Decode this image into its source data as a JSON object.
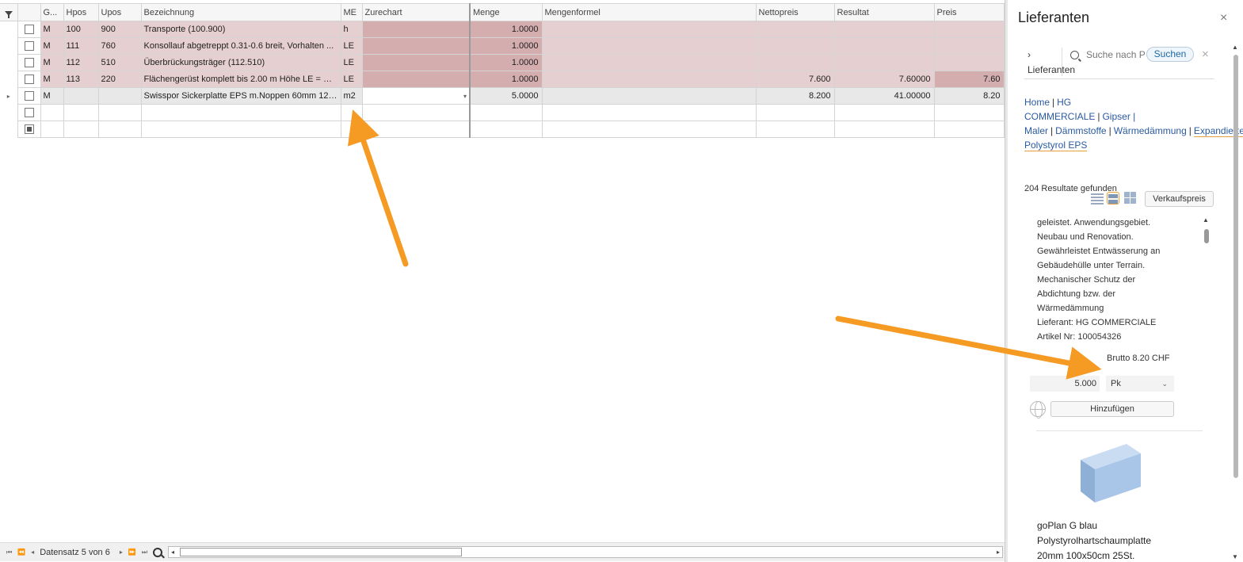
{
  "grid": {
    "columns": [
      "G...",
      "Hpos",
      "Upos",
      "Bezeichnung",
      "ME",
      "Zurechart",
      "Menge",
      "Mengenformel",
      "Nettopreis",
      "Resultat",
      "Preis"
    ],
    "rows": [
      {
        "g": "M",
        "hpos": "100",
        "upos": "900",
        "bez": "Transporte (100.900)",
        "me": "h",
        "zur": "",
        "menge": "1.0000",
        "formel": "",
        "netto": "",
        "resultat": "",
        "preis": ""
      },
      {
        "g": "M",
        "hpos": "111",
        "upos": "760",
        "bez": "Konsollauf abgetreppt 0.31-0.6 breit, Vorhalten ...",
        "me": "LE",
        "zur": "",
        "menge": "1.0000",
        "formel": "",
        "netto": "",
        "resultat": "",
        "preis": ""
      },
      {
        "g": "M",
        "hpos": "112",
        "upos": "510",
        "bez": "Überbrückungsträger (112.510)",
        "me": "LE",
        "zur": "",
        "menge": "1.0000",
        "formel": "",
        "netto": "",
        "resultat": "",
        "preis": ""
      },
      {
        "g": "M",
        "hpos": "113",
        "upos": "220",
        "bez": "Flächengerüst komplett bis 2.00 m Höhe LE = m2...",
        "me": "LE",
        "zur": "",
        "menge": "1.0000",
        "formel": "",
        "netto": "7.600",
        "resultat": "7.60000",
        "preis": "7.60"
      },
      {
        "g": "M",
        "hpos": "",
        "upos": "",
        "bez": "Swisspor Sickerplatte EPS m.Noppen 60mm 125x...",
        "me": "m2",
        "zur": "",
        "menge": "5.0000",
        "formel": "",
        "netto": "8.200",
        "resultat": "41.00000",
        "preis": "8.20"
      }
    ],
    "current_row_indicator": "▸",
    "dropdown_caret": "▾"
  },
  "navigator": {
    "record_text": "Datensatz 5 von 6",
    "first": "⏮",
    "prev_page": "⏪",
    "prev": "◂",
    "next": "▸",
    "next_page": "⏩",
    "last": "⏭",
    "scroll_left": "◂",
    "scroll_right": "▸"
  },
  "panel": {
    "title": "Lieferanten",
    "close": "×",
    "tab_label": "› Lieferanten",
    "search_placeholder": "Suche nach P",
    "search_button": "Suchen",
    "clear": "×",
    "breadcrumb": {
      "home": "Home",
      "c1": "HG COMMERCIALE",
      "c2": "Gipser | Maler",
      "c3": "Dämmstoffe",
      "c4": "Wärmedämmung",
      "c5": "Expandiertes Polystyrol EPS"
    },
    "results_text": "204 Resultate gefunden",
    "price_mode_button": "Verkaufspreis",
    "description_lines": [
      "geleistet. Anwendungsgebiet.",
      "Neubau und Renovation.",
      "Gewährleistet Entwässerung an",
      "Gebäudehülle unter Terrain.",
      "Mechanischer Schutz der",
      "Abdichtung bzw. der",
      "Wärmedämmung",
      "Lieferant: HG COMMERCIALE",
      "Artikel Nr: 100054326"
    ],
    "brutto": "Brutto 8.20 CHF",
    "quantity": "5.000",
    "unit": "Pk",
    "unit_caret": "⌄",
    "add_button": "Hinzufügen",
    "product_name_lines": [
      "goPlan G blau",
      "Polystyrolhartschaumplatte",
      "20mm 100x50cm 25St."
    ],
    "scroll_up": "▲",
    "scroll_down": "▼"
  },
  "colors": {
    "row_highlight": "#e6cfd0",
    "row_highlight_dark": "#d4adaf",
    "current_row": "#e8e8e8",
    "arrow": "#f59a23",
    "link": "#2a5aa0"
  }
}
